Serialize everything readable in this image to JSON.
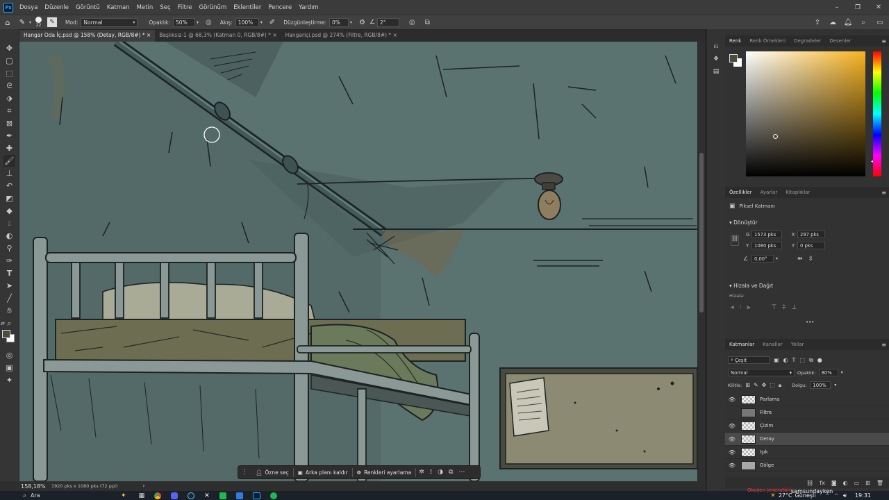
{
  "menu": {
    "app_icon": "Ps",
    "items": [
      "Dosya",
      "Düzenle",
      "Görüntü",
      "Katman",
      "Metin",
      "Seç",
      "Filtre",
      "Görünüm",
      "Eklentiler",
      "Pencere",
      "Yardım"
    ]
  },
  "options": {
    "brush_size": "22",
    "mode_label": "Mod:",
    "mode_value": "Normal",
    "opacity_label": "Opaklık:",
    "opacity_value": "50%",
    "flow_label": "Akış:",
    "flow_value": "100%",
    "smoothing_label": "Düzgünleştirme:",
    "smoothing_value": "0%",
    "angle_value": "2°"
  },
  "tabs": [
    {
      "label": "Hangar Oda İç.psd @ 158% (Detay, RGB/8#) *",
      "close": "×"
    },
    {
      "label": "Başlıksız-1 @ 68,3% (Katman 0, RGB/8#) *",
      "close": "×"
    },
    {
      "label": "Hangariçi.psd @ 274% (Filtre, RGB/8#) *",
      "close": "×"
    }
  ],
  "status": {
    "zoom": "158,18%",
    "doc_info": "1920 pks x 1080 pks (72 ppi)",
    "arrow": "›"
  },
  "context_bar": {
    "select_subject": "Özne seç",
    "remove_bg": "Arka planı kaldır",
    "adjust_colors": "Renkleri ayarlama"
  },
  "color_panel": {
    "tabs": [
      "Renk",
      "Renk Örnekleri",
      "Degradeler",
      "Desenler"
    ],
    "hue_color": "#f7b21e"
  },
  "properties": {
    "tabs": [
      "Özellikler",
      "Ayarlar",
      "Kitaplıklar"
    ],
    "layer_type": "Piksel Katmanı",
    "transform_title": "Dönüştür",
    "w_label": "G",
    "w_value": "1573 pks",
    "x_label": "X",
    "x_value": "297 pks",
    "h_label": "Y",
    "h_value": "1080 pks",
    "y_label": "Y",
    "y_value": "0 pks",
    "angle_value": "0,00°",
    "align_title": "Hizala ve Dağıt",
    "align_label": "Hizala:",
    "more": "•••"
  },
  "layers_panel": {
    "tabs": [
      "Katmanlar",
      "Kanallar",
      "Yollar"
    ],
    "filter_kind": "Çeşit",
    "blend_mode": "Normal",
    "opacity_label": "Opaklık:",
    "opacity_value": "80%",
    "lock_label": "Kilitle:",
    "fill_label": "Dolgu:",
    "fill_value": "100%",
    "layers": [
      {
        "name": "Parlama",
        "visible": true,
        "selected": false
      },
      {
        "name": "Filtre",
        "visible": false,
        "selected": false
      },
      {
        "name": "Çizim",
        "visible": true,
        "selected": false
      },
      {
        "name": "Detay",
        "visible": true,
        "selected": true
      },
      {
        "name": "Işık",
        "visible": true,
        "selected": false
      },
      {
        "name": "Gölge",
        "visible": true,
        "selected": false
      }
    ]
  },
  "taskbar": {
    "search_label": "Ara",
    "notification_text": "Oksijen jeneratörü",
    "user_text": "samsundayken",
    "weather_temp": "27°C",
    "weather_desc": "Güneşli",
    "clock": "19:31"
  }
}
